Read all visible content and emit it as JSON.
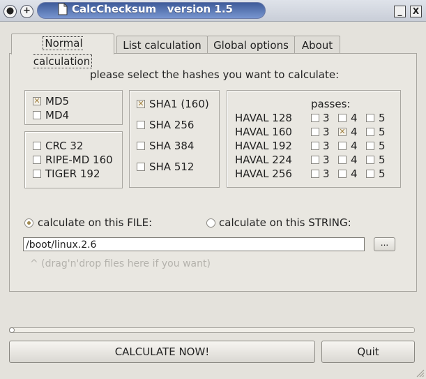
{
  "window": {
    "title": "CalcChecksum   version 1.5",
    "buttons": {
      "close": "●",
      "add": "+",
      "minimize": "_",
      "maximize": "X"
    }
  },
  "tabs": [
    {
      "label": "Normal calculation",
      "active": true
    },
    {
      "label": "List calculation",
      "active": false
    },
    {
      "label": "Global options",
      "active": false
    },
    {
      "label": "About",
      "active": false
    }
  ],
  "instructions": "please select the hashes you want to calculate:",
  "hash_groups": {
    "md": [
      {
        "label": "MD5",
        "checked": true
      },
      {
        "label": "MD4",
        "checked": false
      }
    ],
    "misc": [
      {
        "label": "CRC 32",
        "checked": false
      },
      {
        "label": "RIPE-MD 160",
        "checked": false
      },
      {
        "label": "TIGER 192",
        "checked": false
      }
    ],
    "sha": [
      {
        "label": "SHA1 (160)",
        "checked": true
      },
      {
        "label": "SHA 256",
        "checked": false
      },
      {
        "label": "SHA 384",
        "checked": false
      },
      {
        "label": "SHA 512",
        "checked": false
      }
    ]
  },
  "haval": {
    "passes_label": "passes:",
    "pass_values": [
      "3",
      "4",
      "5"
    ],
    "rows": [
      {
        "label": "HAVAL 128",
        "checked": [
          false,
          false,
          false
        ]
      },
      {
        "label": "HAVAL 160",
        "checked": [
          false,
          true,
          false
        ]
      },
      {
        "label": "HAVAL 192",
        "checked": [
          false,
          false,
          false
        ]
      },
      {
        "label": "HAVAL 224",
        "checked": [
          false,
          false,
          false
        ]
      },
      {
        "label": "HAVAL 256",
        "checked": [
          false,
          false,
          false
        ]
      }
    ]
  },
  "mode": {
    "file_label": "calculate on this FILE:",
    "string_label": "calculate on this STRING:",
    "selected": "file"
  },
  "file_input": {
    "value": "/boot/linux.2.6"
  },
  "browse_label": "...",
  "drop_hint": "^  (drag'n'drop files here if you want)",
  "progress": {
    "value": 0
  },
  "actions": {
    "calculate": "CALCULATE NOW!",
    "quit": "Quit"
  }
}
